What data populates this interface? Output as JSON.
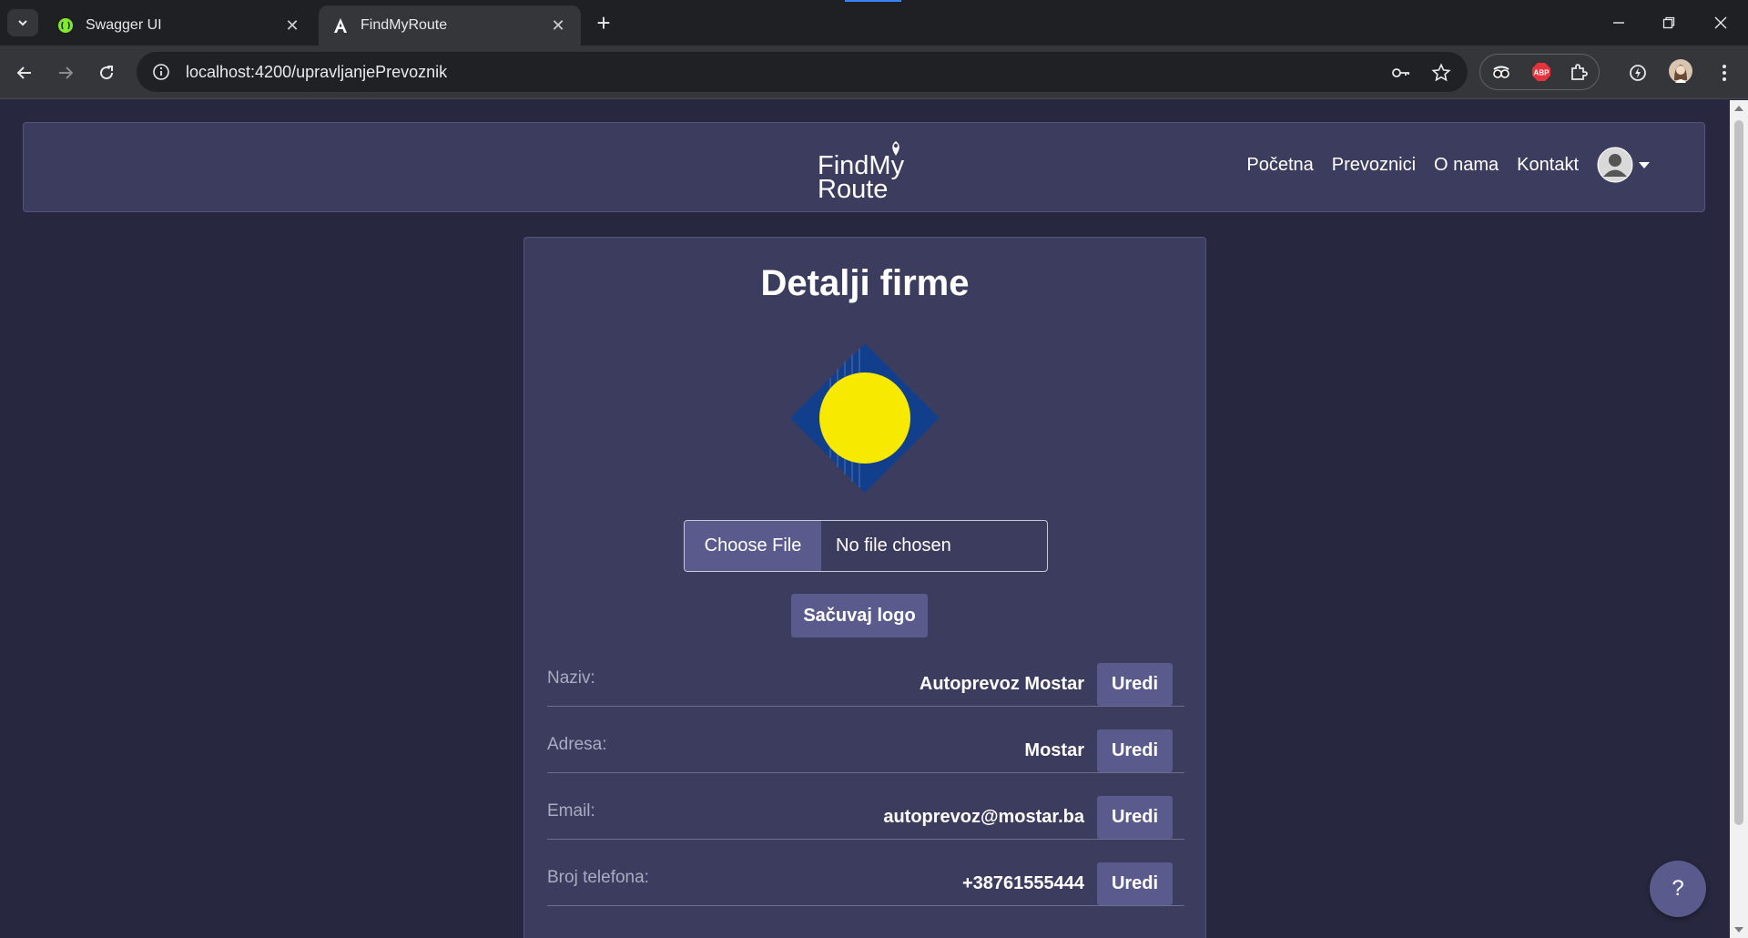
{
  "browser": {
    "tabs": [
      {
        "title": "Swagger UI",
        "active": false,
        "icon": "swagger-icon"
      },
      {
        "title": "FindMyRoute",
        "active": true,
        "icon": "angular-icon"
      }
    ],
    "url": "localhost:4200/upravljanjePrevoznik"
  },
  "navbar": {
    "logo_line1": "FindMy",
    "logo_line2": "Route",
    "links": [
      "Početna",
      "Prevoznici",
      "O nama",
      "Kontakt"
    ]
  },
  "card": {
    "title": "Detalji firme",
    "file_input": {
      "button": "Choose File",
      "status": "No file chosen"
    },
    "save_logo": "Sačuvaj logo",
    "fields": [
      {
        "label": "Naziv:",
        "value": "Autoprevoz Mostar",
        "edit": "Uredi"
      },
      {
        "label": "Adresa:",
        "value": "Mostar",
        "edit": "Uredi"
      },
      {
        "label": "Email:",
        "value": "autoprevoz@mostar.ba",
        "edit": "Uredi"
      },
      {
        "label": "Broj telefona:",
        "value": "+38761555444",
        "edit": "Uredi"
      }
    ]
  },
  "help_button": "?",
  "colors": {
    "page_bg": "#27283f",
    "panel_bg": "#3c3d5e",
    "button_bg": "#5a5b8c",
    "logo_blue": "#123f8c",
    "logo_yellow": "#f7ea00"
  }
}
